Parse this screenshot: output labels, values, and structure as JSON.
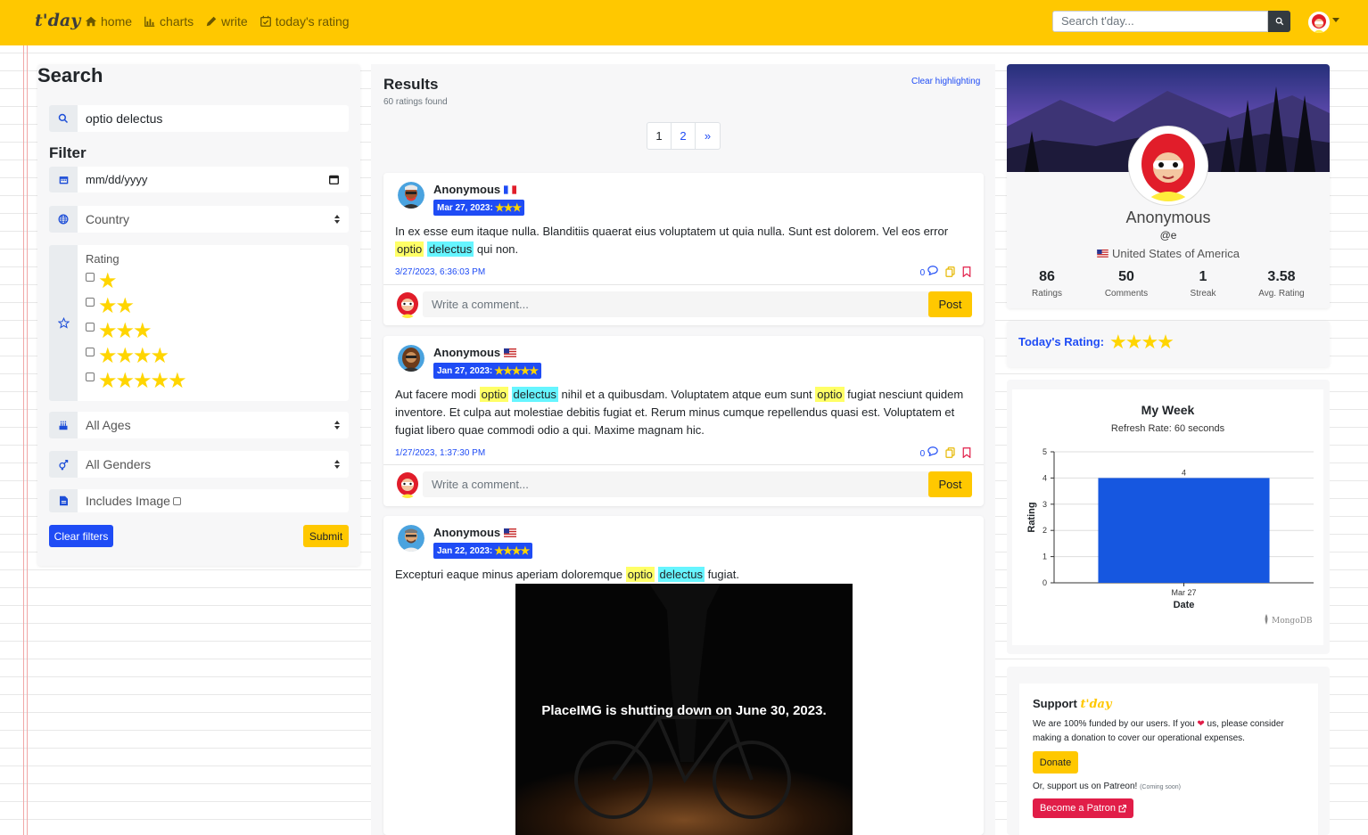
{
  "nav": {
    "brand": "t'day",
    "links": [
      "home",
      "charts",
      "write",
      "today's rating"
    ],
    "search_placeholder": "Search t'day..."
  },
  "search_panel": {
    "title": "Search",
    "query": "optio delectus",
    "filter_title": "Filter",
    "date_placeholder": "mm/dd/yyyy",
    "country": "Country",
    "rating_label": "Rating",
    "rating_options": [
      "★",
      "★★",
      "★★★",
      "★★★★",
      "★★★★★"
    ],
    "ages": "All Ages",
    "genders": "All Genders",
    "includes_image": "Includes Image",
    "clear_filters": "Clear filters",
    "submit": "Submit"
  },
  "results": {
    "title": "Results",
    "count": "60 ratings found",
    "clear_highlighting": "Clear highlighting",
    "pages": [
      "1",
      "2",
      "»"
    ],
    "posts": [
      {
        "author": "Anonymous",
        "badge_date": "Mar 27, 2023:",
        "rating": 3,
        "stars": "★★★",
        "text_before": "In ex esse eum itaque nulla. Blanditiis quaerat eius voluptatem ut quia nulla. Sunt est dolorem. Vel eos error",
        "hl1": "optio",
        "hl2": "delectus",
        "text_after": "qui non.",
        "timestamp": "3/27/2023, 6:36:03 PM",
        "comments": "0",
        "comment_placeholder": "Write a comment...",
        "post": "Post"
      },
      {
        "author": "Anonymous",
        "badge_date": "Jan 27, 2023:",
        "rating": 5,
        "stars": "★★★★★",
        "text_1": "Aut facere modi",
        "hl1": "optio",
        "hl2": "delectus",
        "text_2": "nihil et a quibusdam. Voluptatem atque eum sunt",
        "hl3": "optio",
        "text_3": "fugiat nesciunt quidem inventore. Et culpa aut molestiae debitis fugiat et. Rerum minus cumque repellendus quasi est. Voluptatem et fugiat libero quae commodi odio a qui. Maxime magnam hic.",
        "timestamp": "1/27/2023, 1:37:30 PM",
        "comments": "0",
        "comment_placeholder": "Write a comment...",
        "post": "Post"
      },
      {
        "author": "Anonymous",
        "badge_date": "Jan 22, 2023:",
        "rating": 4,
        "stars": "★★★★",
        "text_before": "Excepturi eaque minus aperiam doloremque",
        "hl1": "optio",
        "hl2": "delectus",
        "text_after": "fugiat.",
        "image_text": "PlaceIMG is shutting down on June 30, 2023."
      }
    ]
  },
  "profile": {
    "name": "Anonymous",
    "handle": "@e",
    "country": "United States of America",
    "stats": [
      {
        "num": "86",
        "label": "Ratings"
      },
      {
        "num": "50",
        "label": "Comments"
      },
      {
        "num": "1",
        "label": "Streak"
      },
      {
        "num": "3.58",
        "label": "Avg. Rating"
      }
    ]
  },
  "today": {
    "label": "Today's Rating:",
    "rating": 4,
    "stars": "★★★★"
  },
  "week": {
    "title": "My Week",
    "subtitle": "Refresh Rate: 60 seconds",
    "watermark": "MongoDB"
  },
  "chart_data": {
    "type": "bar",
    "categories": [
      "Mar 27"
    ],
    "values": [
      4
    ],
    "data_labels": [
      "4"
    ],
    "xlabel": "Date",
    "ylabel": "Rating",
    "ylim": [
      0,
      5
    ],
    "yticks": [
      "0",
      "1",
      "2",
      "3",
      "4",
      "5"
    ],
    "color": "#1657e0",
    "grid": true
  },
  "support": {
    "title": "Support",
    "brand": "t'day",
    "text_1": "We are 100% funded by our users. If you",
    "text_2": "us, please consider making a donation to cover our operational expenses.",
    "donate": "Donate",
    "patreon_text": "Or, support us on Patreon!",
    "coming_soon": "(Coming soon)",
    "patron_button": "Become a Patron"
  }
}
